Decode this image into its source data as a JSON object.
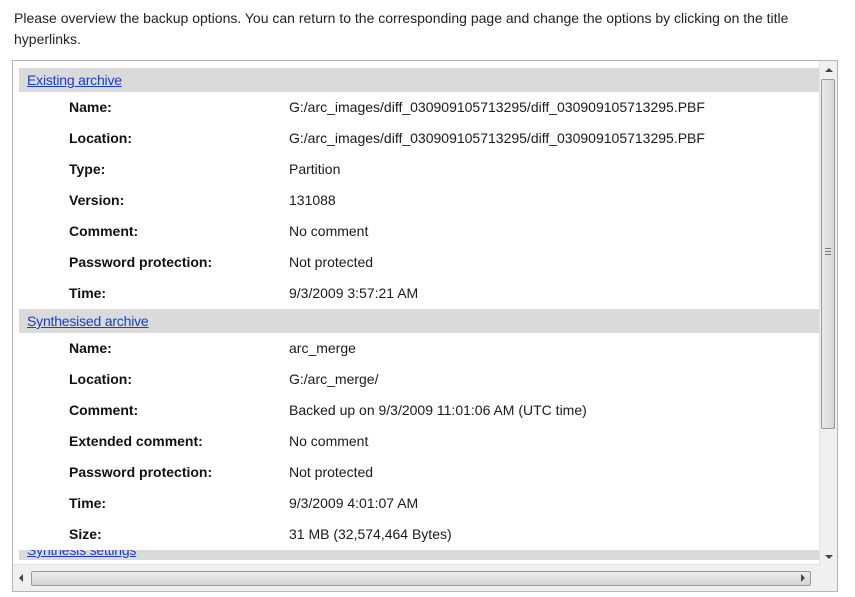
{
  "intro_text": "Please overview the backup options. You can return to the corresponding page and change the options by clicking on the title hyperlinks.",
  "sections": [
    {
      "title": "Existing archive",
      "rows": [
        {
          "label": "Name:",
          "value": "G:/arc_images/diff_030909105713295/diff_030909105713295.PBF"
        },
        {
          "label": "Location:",
          "value": "G:/arc_images/diff_030909105713295/diff_030909105713295.PBF"
        },
        {
          "label": "Type:",
          "value": "Partition"
        },
        {
          "label": "Version:",
          "value": "131088"
        },
        {
          "label": "Comment:",
          "value": "No comment"
        },
        {
          "label": "Password protection:",
          "value": "Not protected"
        },
        {
          "label": "Time:",
          "value": "9/3/2009 3:57:21 AM"
        }
      ]
    },
    {
      "title": "Synthesised archive",
      "rows": [
        {
          "label": "Name:",
          "value": "arc_merge"
        },
        {
          "label": "Location:",
          "value": "G:/arc_merge/"
        },
        {
          "label": "Comment:",
          "value": "Backed up on 9/3/2009 11:01:06 AM (UTC time)"
        },
        {
          "label": "Extended comment:",
          "value": "No comment"
        },
        {
          "label": "Password protection:",
          "value": "Not protected"
        },
        {
          "label": "Time:",
          "value": "9/3/2009 4:01:07 AM"
        },
        {
          "label": "Size:",
          "value": "31 MB (32,574,464 Bytes)"
        }
      ]
    },
    {
      "title": "Synthesis settings",
      "rows": []
    }
  ],
  "icons": {
    "scroll_up": "up-arrow-icon",
    "scroll_down": "down-arrow-icon",
    "scroll_left": "left-arrow-icon",
    "scroll_right": "right-arrow-icon"
  },
  "colors": {
    "link": "#1a3bd0",
    "section_header_bg": "#dadada"
  }
}
